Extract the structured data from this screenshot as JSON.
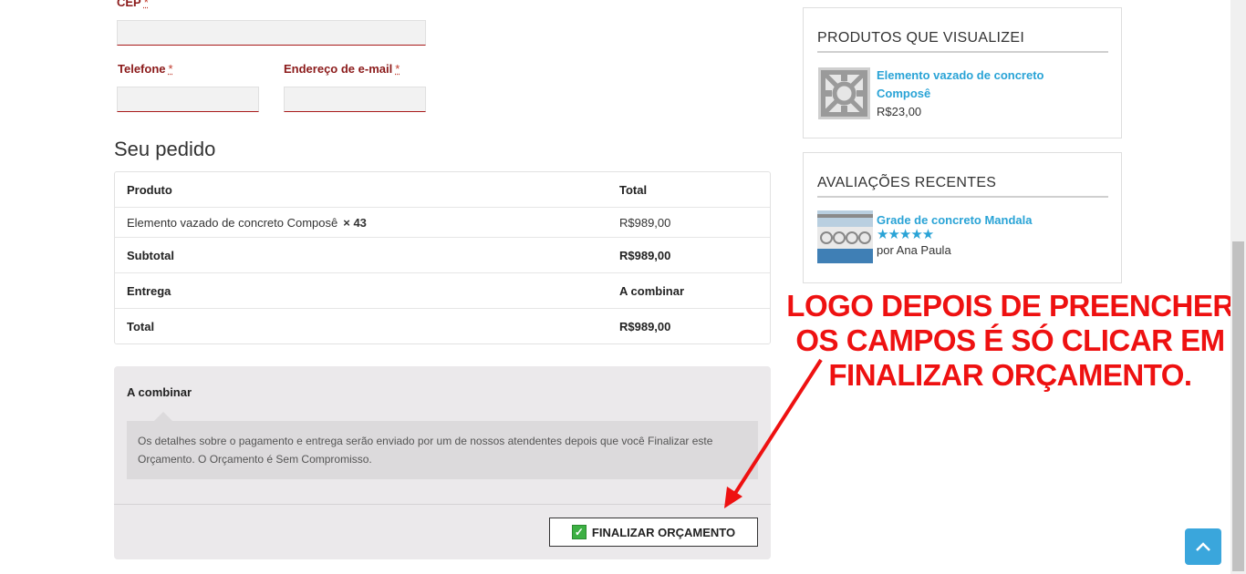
{
  "form": {
    "cep_label": "CEP",
    "telefone_label": "Telefone",
    "email_label": "Endereço de e-mail",
    "required_mark": "*",
    "cep_value": "",
    "telefone_value": "",
    "email_value": ""
  },
  "order": {
    "title": "Seu pedido",
    "header_product": "Produto",
    "header_total": "Total",
    "items": [
      {
        "name": "Elemento vazado de concreto Composê",
        "qty": "× 43",
        "total": "R$989,00"
      }
    ],
    "subtotal_label": "Subtotal",
    "subtotal_value": "R$989,00",
    "shipping_label": "Entrega",
    "shipping_value": "A combinar",
    "total_label": "Total",
    "total_value": "R$989,00"
  },
  "payment": {
    "method": "A combinar",
    "description": "Os detalhes sobre o pagamento e entrega serão enviado por um de nossos atendentes depois que você Finalizar este Orçamento. O Orçamento é Sem Compromisso.",
    "button_label": "FINALIZAR ORÇAMENTO",
    "button_icon": "check-icon"
  },
  "sidebar": {
    "viewed": {
      "title": "PRODUTOS QUE VISUALIZEI",
      "product_name": "Elemento vazado de concreto Composê",
      "product_price": "R$23,00"
    },
    "reviews": {
      "title": "AVALIAÇÕES RECENTES",
      "product_name": "Grade de concreto Mandala",
      "rating": 5,
      "rating_max": 5,
      "stars": "★★★★★",
      "author": "por Ana Paula"
    }
  },
  "annotation": {
    "lines": [
      "LOGO DEPOIS DE PREENCHER",
      "OS CAMPOS É SÓ CLICAR EM",
      "FINALIZAR ORÇAMENTO."
    ],
    "color": "#ee1111"
  },
  "colors": {
    "accent_link": "#29a3d6",
    "label_red": "#8b1a1a",
    "scroll_button": "#3aa6dc"
  }
}
